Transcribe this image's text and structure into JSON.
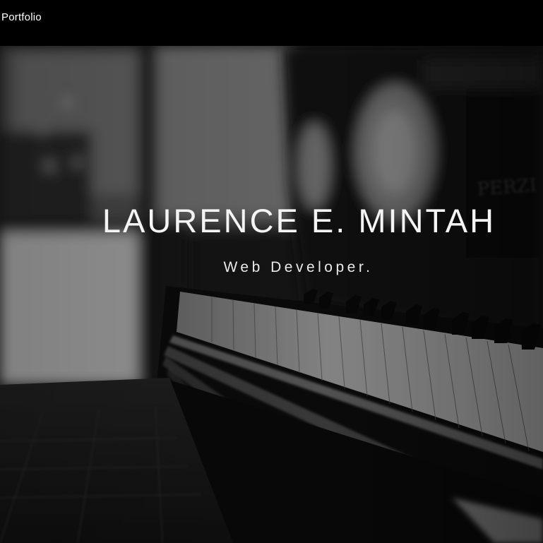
{
  "navbar": {
    "brand": "Portfolio"
  },
  "hero": {
    "name": "LAURENCE E. MINTAH",
    "role": "Web Developer.",
    "background": "black-and-white-piano-photo"
  },
  "colors": {
    "navbar_bg": "#000000",
    "text": "#ffffff"
  }
}
